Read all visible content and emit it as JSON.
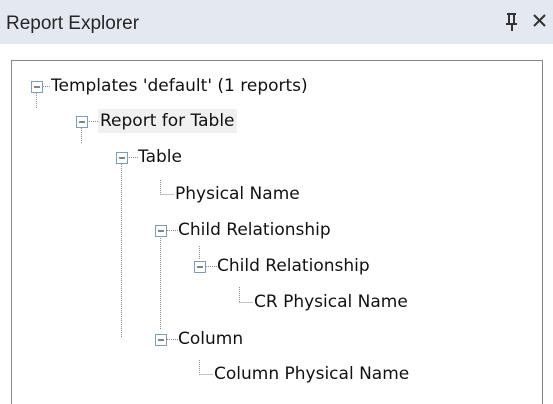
{
  "panel": {
    "title": "Report Explorer",
    "pin_icon": "pin-icon",
    "close_icon": "close-icon"
  },
  "tree": {
    "nodes": [
      {
        "label": "Templates 'default' (1 reports)",
        "expanded": true
      },
      {
        "label": "Report for Table",
        "expanded": true,
        "selected": true
      },
      {
        "label": "Table",
        "expanded": true
      },
      {
        "label": "Physical Name"
      },
      {
        "label": "Child Relationship",
        "expanded": true
      },
      {
        "label": "Child Relationship",
        "expanded": true
      },
      {
        "label": "CR Physical Name"
      },
      {
        "label": "Column",
        "expanded": true
      },
      {
        "label": "Column Physical Name"
      }
    ]
  },
  "colors": {
    "title_bar": "#e3e8f1",
    "tree_border": "#828790",
    "selection": "#f0f0f0"
  }
}
